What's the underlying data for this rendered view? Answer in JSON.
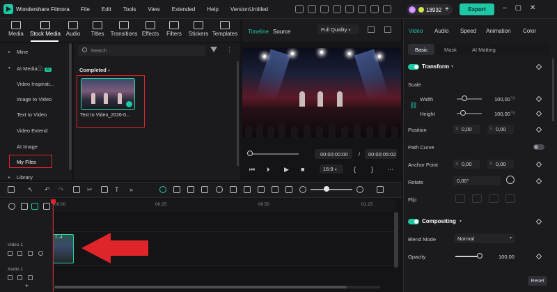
{
  "titlebar": {
    "app_name": "Wondershare Filmora",
    "menu": [
      "File",
      "Edit",
      "Tools",
      "View",
      "Extended",
      "Help",
      "Version"
    ],
    "project_name": "Untitled",
    "credits": "18932",
    "export_label": "Export"
  },
  "media_tabs": [
    {
      "label": "Media",
      "icon": "media-icon"
    },
    {
      "label": "Stock Media",
      "icon": "stock-media-icon",
      "active": true
    },
    {
      "label": "Audio",
      "icon": "audio-icon"
    },
    {
      "label": "Titles",
      "icon": "titles-icon"
    },
    {
      "label": "Transitions",
      "icon": "transitions-icon"
    },
    {
      "label": "Effects",
      "icon": "effects-icon"
    },
    {
      "label": "Filters",
      "icon": "filters-icon"
    },
    {
      "label": "Stickers",
      "icon": "stickers-icon"
    },
    {
      "label": "Templates",
      "icon": "templates-icon"
    }
  ],
  "sidebar": {
    "items": [
      {
        "label": "Mine",
        "arrow": true
      },
      {
        "label": "AI Media",
        "arrow": true,
        "badge": "AI"
      },
      {
        "label": "Video Inspirati..."
      },
      {
        "label": "Image to Video"
      },
      {
        "label": "Text to Video"
      },
      {
        "label": "Video Extend"
      },
      {
        "label": "AI Image"
      },
      {
        "label": "My Files",
        "highlighted": true
      },
      {
        "label": "Library",
        "arrow": true
      }
    ]
  },
  "browser": {
    "search_placeholder": "Search",
    "section_label": "Completed",
    "item_name": "Text to Video_2026-0..."
  },
  "player": {
    "tab_timeline": "Timeline",
    "tab_source": "Source",
    "quality": "Full Quality",
    "current_time": "00:00:00:00",
    "separator": "/",
    "total_time": "00:00:05:02",
    "aspect_ratio": "16:9"
  },
  "properties": {
    "tabs": [
      "Video",
      "Audio",
      "Speed",
      "Animation",
      "Color"
    ],
    "subtabs": [
      "Basic",
      "Mask",
      "AI Matting"
    ],
    "transform_title": "Transform",
    "scale_label": "Scale",
    "width_label": "Width",
    "width_value": "100,00",
    "height_label": "Height",
    "height_value": "100,00",
    "percent": "%",
    "position_label": "Position",
    "position_x": "0,00",
    "position_y": "0,00",
    "path_curve_label": "Path Curve",
    "anchor_label": "Anchor Point",
    "anchor_x": "0,00",
    "anchor_y": "0,00",
    "rotate_label": "Rotate",
    "rotate_value": "0,00°",
    "flip_label": "Flip",
    "compositing_title": "Compositing",
    "blend_label": "Blend Mode",
    "blend_value": "Normal",
    "opacity_label": "Opacity",
    "opacity_value": "100,00",
    "reset_label": "Reset",
    "axis_x": "X",
    "axis_y": "Y"
  },
  "timeline": {
    "ruler": [
      "00:00",
      "00:25",
      "00:50",
      "01:15"
    ],
    "tracks": [
      {
        "label": "Video 1"
      },
      {
        "label": "Audio 1"
      }
    ],
    "clip_label": "T...4"
  },
  "colors": {
    "accent": "#1fc8a5",
    "highlight_red": "#e0252a"
  }
}
